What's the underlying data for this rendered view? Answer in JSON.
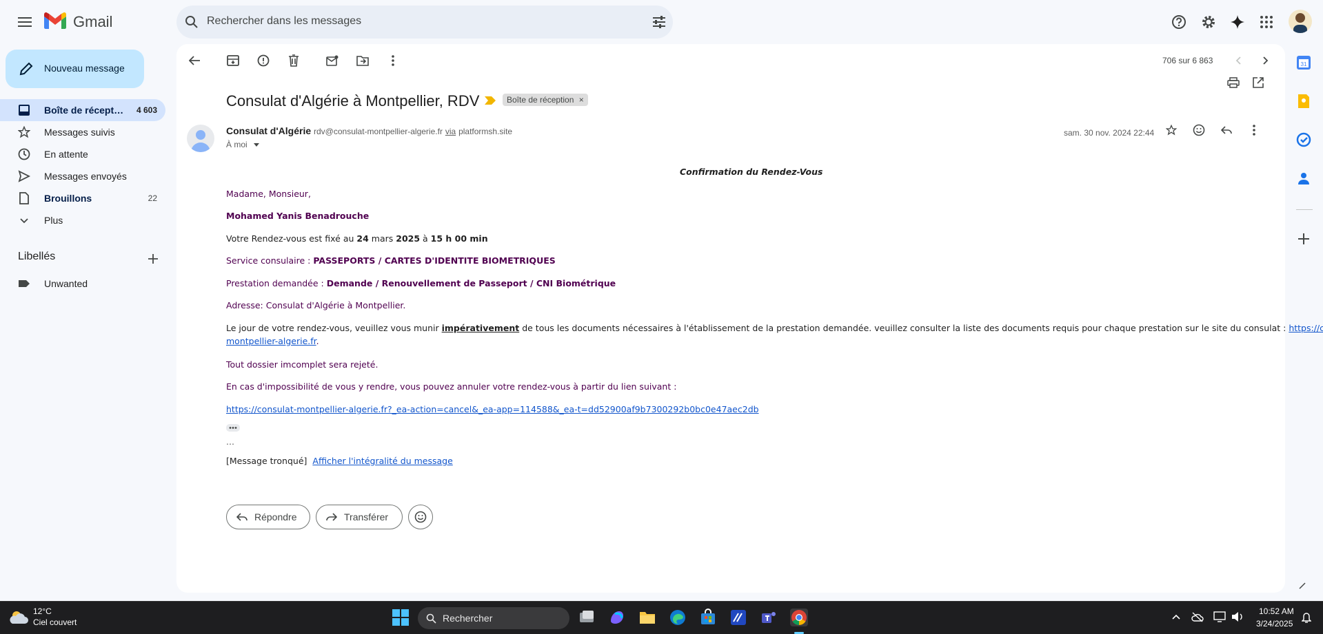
{
  "app": {
    "name": "Gmail"
  },
  "search": {
    "placeholder": "Rechercher dans les messages"
  },
  "sidebar": {
    "compose_label": "Nouveau message",
    "items": [
      {
        "label": "Boîte de récept…",
        "count": "4 603",
        "icon": "inbox-icon"
      },
      {
        "label": "Messages suivis",
        "count": "",
        "icon": "star-icon"
      },
      {
        "label": "En attente",
        "count": "",
        "icon": "clock-icon"
      },
      {
        "label": "Messages envoyés",
        "count": "",
        "icon": "send-icon"
      },
      {
        "label": "Brouillons",
        "count": "22",
        "icon": "draft-icon"
      },
      {
        "label": "Plus",
        "count": "",
        "icon": "chevron-down-icon"
      }
    ],
    "labels_title": "Libellés",
    "labels": [
      {
        "label": "Unwanted",
        "icon": "label-icon"
      }
    ]
  },
  "toolbar": {
    "pagination": "706 sur 6 863"
  },
  "email": {
    "subject": "Consulat d'Algérie à Montpellier, RDV",
    "tag": "Boîte de réception",
    "tag_close": "×",
    "sender_name": "Consulat d'Algérie",
    "sender_email": "rdv@consulat-montpellier-algerie.fr",
    "via_label": "via",
    "via_domain": "platformsh.site",
    "recipient": "À moi",
    "date": "sam. 30 nov. 2024 22:44",
    "body": {
      "heading": "Confirmation du Rendez-Vous",
      "greeting": "Madame, Monsieur,",
      "name": "Mohamed Yanis  Benadrouche",
      "appt_prefix": "Votre Rendez-vous est fixé au ",
      "appt_date": "24",
      "appt_month": " mars ",
      "appt_year": "2025",
      "appt_mid": " à ",
      "appt_time": "15 h 00 min",
      "service_label": "Service consulaire : ",
      "service_value": "PASSEPORTS / CARTES D'IDENTITE BIOMETRIQUES",
      "prestation_label": "Prestation demandée : ",
      "prestation_value": "Demande / Renouvellement de Passeport / CNI Biométrique",
      "address": "Adresse: Consulat d'Algérie à Montpellier.",
      "docs_pre": "Le jour de votre rendez-vous, veuillez vous munir ",
      "docs_bold": "impérativement",
      "docs_post": " de tous les documents nécessaires à l'établissement de la prestation demandée. veuillez consulter la liste des documents requis pour chaque prestation sur le site du consulat : ",
      "docs_link1": "https://consulat-",
      "docs_link2": "montpellier-algerie.fr",
      "docs_end": ".",
      "incomplete": "Tout dossier imcomplet sera rejeté.",
      "cancel_text": "En cas d'impossibilité de vous y rendre, vous pouvez annuler votre rendez-vous à partir du lien suivant :",
      "cancel_link": "https://consulat-montpellier-algerie.fr?_ea-action=cancel&_ea-app=114588&_ea-t=dd52900af9b7300292b0bc0e47aec2db",
      "ellipsis": "...",
      "truncated": "[Message tronqué]",
      "show_full": "Afficher l'intégralité du message"
    }
  },
  "actions": {
    "reply": "Répondre",
    "forward": "Transférer"
  },
  "taskbar": {
    "weather_temp": "12°C",
    "weather_desc": "Ciel couvert",
    "search": "Rechercher",
    "time": "10:52 AM",
    "date": "3/24/2025"
  },
  "colors": {
    "compose": "#c2e7ff",
    "active_nav": "#d3e3fd",
    "body_text": "#500050",
    "link": "#1155cc"
  }
}
